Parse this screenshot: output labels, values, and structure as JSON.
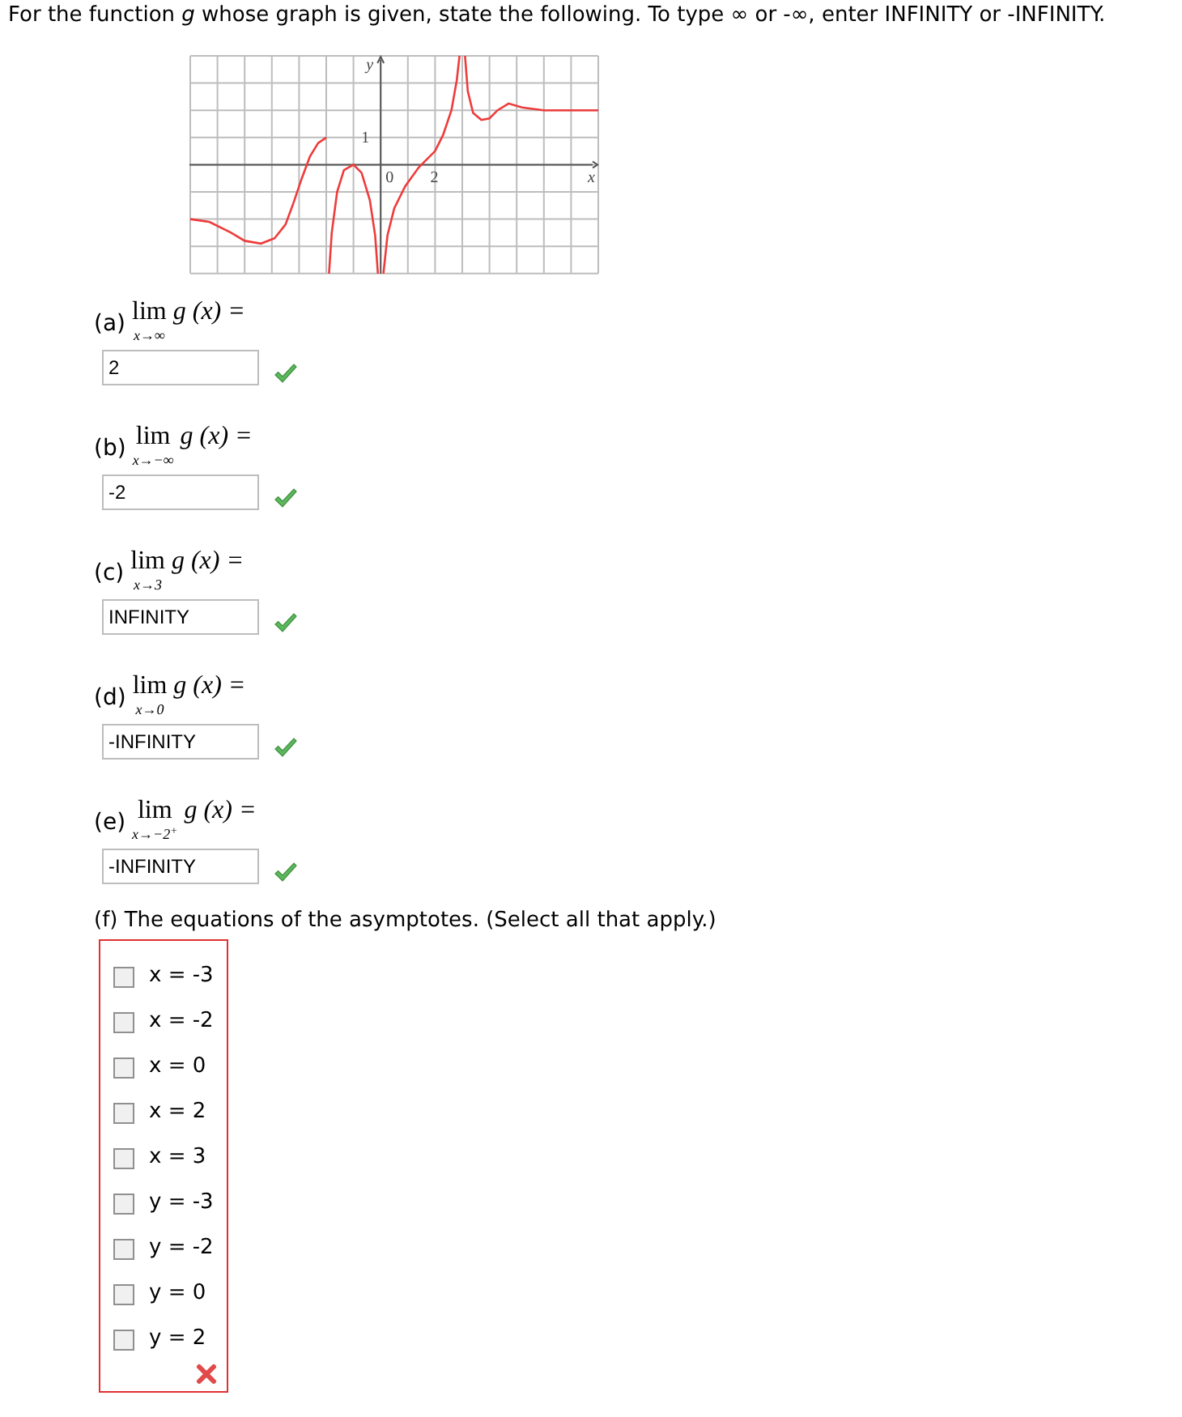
{
  "intro": "For the function *g* whose graph is given, state the following. To type ∞ or -∞, enter INFINITY or -INFINITY.",
  "graph": {
    "y_label": "y",
    "x_label": "x",
    "y_tick_labels": [
      "1"
    ],
    "x_tick_labels": [
      "0",
      "2"
    ]
  },
  "parts": [
    {
      "label": "(a)",
      "lim": "lim",
      "under": "x→∞",
      "expr": "g (x) =",
      "answer": "2",
      "correct": true
    },
    {
      "label": "(b)",
      "lim": "lim",
      "under": "x→−∞",
      "expr": "g (x) =",
      "answer": "-2",
      "correct": true
    },
    {
      "label": "(c)",
      "lim": "lim",
      "under": "x→3",
      "expr": "g (x) =",
      "answer": "INFINITY",
      "correct": true
    },
    {
      "label": "(d)",
      "lim": "lim",
      "under": "x→0",
      "expr": "g (x) =",
      "answer": "-INFINITY",
      "correct": true
    },
    {
      "label": "(e)",
      "lim": "lim",
      "under": "x→−2$^{+}$",
      "expr": "g (x) =",
      "answer": "-INFINITY",
      "correct": true
    }
  ],
  "asymptotes": {
    "prompt": "(f) The equations of the asymptotes. (Select all that apply.)",
    "correct": false,
    "options": [
      {
        "label": "x = -3",
        "checked": false
      },
      {
        "label": "x = -2",
        "checked": false
      },
      {
        "label": "x = 0",
        "checked": false
      },
      {
        "label": "x = 2",
        "checked": false
      },
      {
        "label": "x = 3",
        "checked": false
      },
      {
        "label": "y = -3",
        "checked": false
      },
      {
        "label": "y = -2",
        "checked": false
      },
      {
        "label": "y = 0",
        "checked": false
      },
      {
        "label": "y = 2",
        "checked": false
      }
    ]
  }
}
